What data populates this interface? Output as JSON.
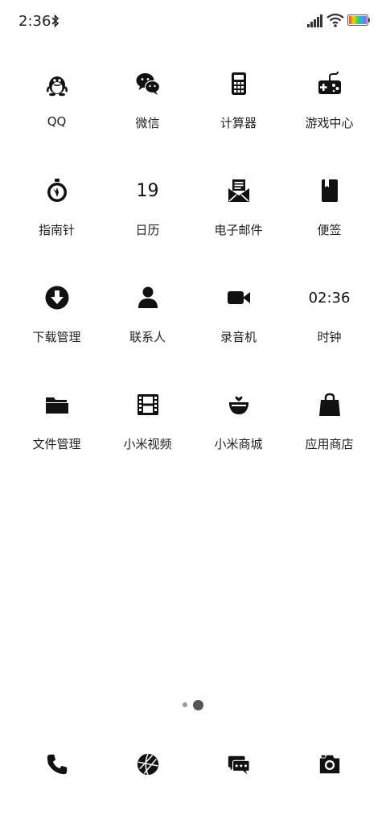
{
  "status_bar": {
    "time": "2:36",
    "icons": [
      "bluetooth-icon",
      "signal-icon",
      "wifi-icon",
      "battery-icon"
    ]
  },
  "apps": [
    [
      {
        "label": "QQ",
        "icon": "qq-penguin-icon"
      },
      {
        "label": "微信",
        "icon": "wechat-icon"
      },
      {
        "label": "计算器",
        "icon": "calculator-icon"
      },
      {
        "label": "游戏中心",
        "icon": "gamepad-icon"
      }
    ],
    [
      {
        "label": "指南针",
        "icon": "compass-icon"
      },
      {
        "label": "日历",
        "icon": "calendar-icon",
        "icon_text": "19"
      },
      {
        "label": "电子邮件",
        "icon": "email-icon"
      },
      {
        "label": "便签",
        "icon": "notes-icon"
      }
    ],
    [
      {
        "label": "下载管理",
        "icon": "download-icon"
      },
      {
        "label": "联系人",
        "icon": "contacts-icon"
      },
      {
        "label": "录音机",
        "icon": "recorder-icon"
      },
      {
        "label": "时钟",
        "icon": "clock-icon",
        "icon_text": "02:36"
      }
    ],
    [
      {
        "label": "文件管理",
        "icon": "folder-icon"
      },
      {
        "label": "小米视频",
        "icon": "film-icon"
      },
      {
        "label": "小米商城",
        "icon": "basket-icon"
      },
      {
        "label": "应用商店",
        "icon": "shopping-bag-icon"
      }
    ]
  ],
  "page_indicator": {
    "pages": 2,
    "current": 2
  },
  "dock": [
    "phone-icon",
    "browser-icon",
    "messages-icon",
    "camera-icon"
  ]
}
